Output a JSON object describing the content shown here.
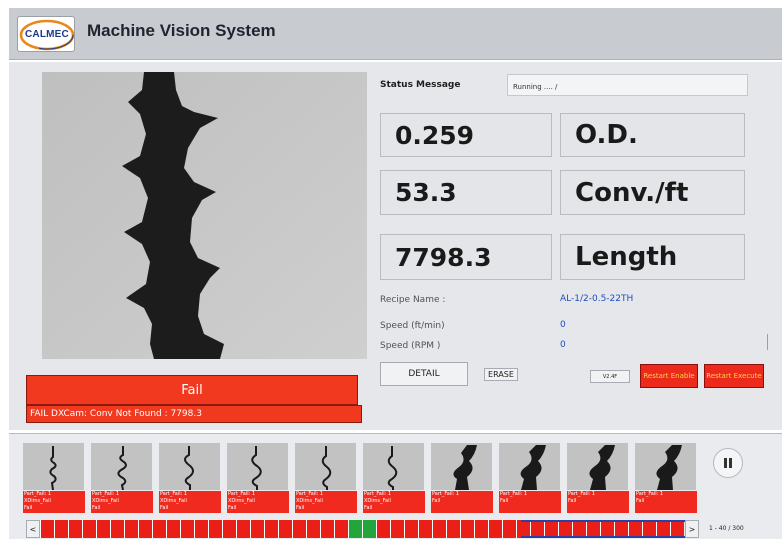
{
  "header": {
    "logo_text": "CALMEC",
    "app_title": "Machine Vision System"
  },
  "status": {
    "label": "Status Message",
    "message": "Running .... /"
  },
  "metrics": [
    {
      "value": "0.259",
      "unit": "O.D."
    },
    {
      "value": "53.3",
      "unit": "Conv./ft"
    },
    {
      "value": "7798.3",
      "unit": "Length"
    }
  ],
  "recipe": {
    "label": "Recipe Name :",
    "value": "AL-1/2-0.5-22TH"
  },
  "speed_ft": {
    "label": "Speed (ft/min)",
    "value": "0"
  },
  "speed_rpm": {
    "label": "Speed (RPM )",
    "value": "0"
  },
  "result": {
    "fail_label": "Fail",
    "error_message": "FAIL DXCam: Conv Not Found : 7798.3"
  },
  "buttons": {
    "detail": "DETAIL",
    "erase": "ERASE",
    "version": "V2.4F",
    "restart_enable": "Restart Enable",
    "restart_execute": "Restart Execute"
  },
  "gallery": {
    "thumbnails": [
      {
        "line1": "Part_Fail: 1",
        "line2": "XDims_Fail",
        "line3": "Fail"
      },
      {
        "line1": "Part_Fail: 1",
        "line2": "XDims_Fail",
        "line3": "Fail"
      },
      {
        "line1": "Part_Fail: 1",
        "line2": "XDims_Fail",
        "line3": "Fail"
      },
      {
        "line1": "Part_Fail: 1",
        "line2": "XDims_Fail",
        "line3": "Fail"
      },
      {
        "line1": "Part_Fail: 1",
        "line2": "XDims_Fail",
        "line3": "Fail"
      },
      {
        "line1": "Part_Fail: 1",
        "line2": "XDims_Fail",
        "line3": "Fail"
      },
      {
        "line1": "Part_Fail: 1",
        "line2": "Fail",
        "line3": ""
      },
      {
        "line1": "Part_Fail: 1",
        "line2": "Fail",
        "line3": ""
      },
      {
        "line1": "Part_Fail: 1",
        "line2": "Fail",
        "line3": ""
      },
      {
        "line1": "Part_Fail: 1",
        "line2": "Fail",
        "line3": ""
      }
    ],
    "prev_label": "<",
    "next_label": ">",
    "page_indicator": "1 - 40 / 300",
    "pause_icon": "pause-icon",
    "strip": [
      "fail",
      "fail",
      "fail",
      "fail",
      "fail",
      "fail",
      "fail",
      "fail",
      "fail",
      "fail",
      "fail",
      "fail",
      "fail",
      "fail",
      "fail",
      "fail",
      "fail",
      "fail",
      "fail",
      "fail",
      "fail",
      "fail",
      "pass",
      "pass",
      "fail",
      "fail",
      "fail",
      "fail",
      "fail",
      "fail",
      "fail",
      "fail",
      "fail",
      "fail",
      "fail",
      "fail",
      "fail",
      "fail",
      "fail",
      "fail",
      "fail",
      "fail",
      "fail",
      "fail",
      "fail",
      "fail"
    ]
  },
  "colors": {
    "fail": "#ea1f18",
    "pass": "#22a53a",
    "accent_blue": "#1f4ec0",
    "selection": "#2c3ea8"
  }
}
